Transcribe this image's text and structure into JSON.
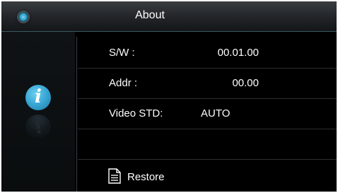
{
  "header": {
    "title": "About",
    "back_icon": "circle-back-icon"
  },
  "sidebar": {
    "icon": "info-icon",
    "icon_glyph": "i",
    "accent_color": "#3aa9d6"
  },
  "info_rows": [
    {
      "label": "S/W :",
      "value": "00.01.00"
    },
    {
      "label": "Addr :",
      "value": "00.00"
    },
    {
      "label": "Video STD:",
      "value": "AUTO"
    }
  ],
  "footer": {
    "restore_label": "Restore",
    "restore_icon": "document-icon"
  }
}
